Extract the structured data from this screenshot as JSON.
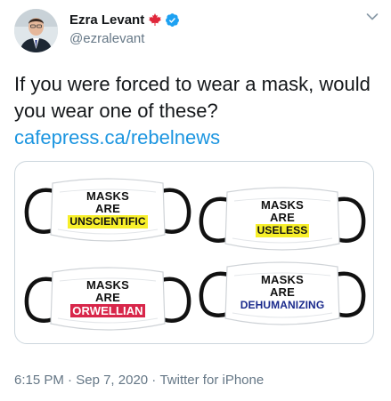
{
  "author": {
    "name": "Ezra Levant",
    "handle": "@ezralevant",
    "flag_icon": "canada-maple-leaf-icon",
    "verified_icon": "verified-badge-icon"
  },
  "tweet": {
    "text": "If you were forced to wear a mask, would you wear one of these?",
    "link": "cafepress.ca/rebelnews"
  },
  "media": {
    "masks": [
      {
        "line1": "MASKS",
        "line2": "ARE",
        "highlight": "UNSCIENTIFIC",
        "highlight_bg": "#f7ef2a",
        "highlight_color": "#111111"
      },
      {
        "line1": "MASKS",
        "line2": "ARE",
        "highlight": "USELESS",
        "highlight_bg": "#f7ef2a",
        "highlight_color": "#111111"
      },
      {
        "line1": "MASKS",
        "line2": "ARE",
        "highlight": "ORWELLIAN",
        "highlight_bg": "#d8264a",
        "highlight_color": "#ffffff"
      },
      {
        "line1": "MASKS",
        "line2": "ARE",
        "highlight": "DEHUMANIZING",
        "highlight_bg": "#ffffff",
        "highlight_color": "#1a2a8c"
      }
    ]
  },
  "meta": {
    "time": "6:15 PM",
    "separator1": " · ",
    "date": "Sep 7, 2020",
    "separator2": " · ",
    "source": "Twitter for iPhone"
  },
  "colors": {
    "link": "#1b95e0",
    "secondary_text": "#657786",
    "verified_blue": "#1da1f2",
    "flag_red": "#e0263a"
  }
}
